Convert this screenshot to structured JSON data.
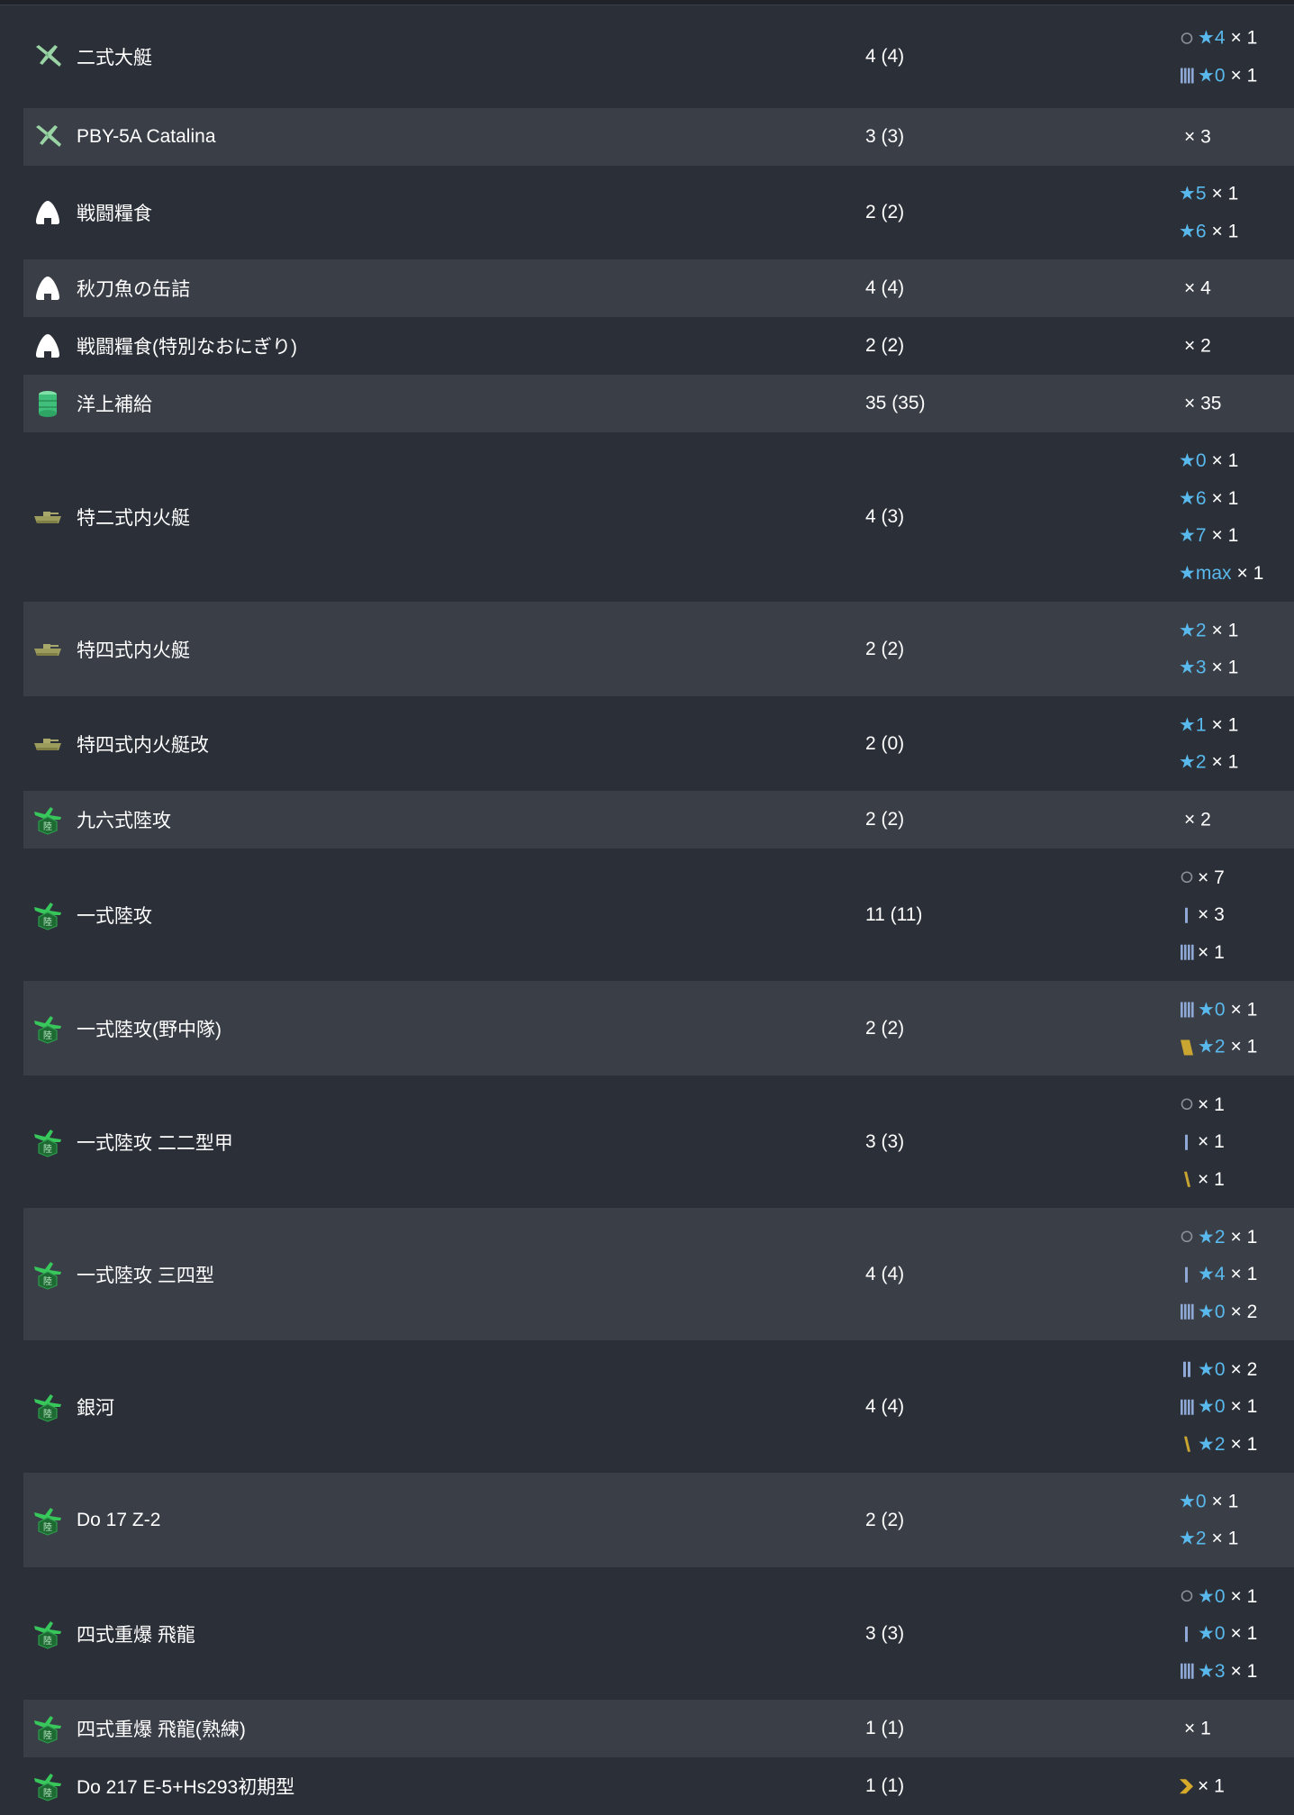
{
  "rows": [
    {
      "icon": "flying-boat-icon",
      "name": "二式大艇",
      "count": "4 (4)",
      "improvements": [
        {
          "prof": "circle",
          "star": "★4",
          "mult": "× 1"
        },
        {
          "prof": "bars4",
          "star": "★0",
          "mult": "× 1"
        }
      ]
    },
    {
      "icon": "flying-boat-icon",
      "name": "PBY-5A Catalina",
      "count": "3 (3)",
      "improvements": [
        {
          "prof": "none",
          "star": "",
          "mult": "× 3"
        }
      ]
    },
    {
      "icon": "ration-icon",
      "name": "戦闘糧食",
      "count": "2 (2)",
      "improvements": [
        {
          "prof": "",
          "star": "★5",
          "mult": "× 1"
        },
        {
          "prof": "",
          "star": "★6",
          "mult": "× 1"
        }
      ]
    },
    {
      "icon": "ration-icon",
      "name": "秋刀魚の缶詰",
      "count": "4 (4)",
      "improvements": [
        {
          "prof": "none",
          "star": "",
          "mult": "× 4"
        }
      ]
    },
    {
      "icon": "ration-icon",
      "name": "戦闘糧食(特別なおにぎり)",
      "count": "2 (2)",
      "improvements": [
        {
          "prof": "none",
          "star": "",
          "mult": "× 2"
        }
      ]
    },
    {
      "icon": "supply-drum-icon",
      "name": "洋上補給",
      "count": "35 (35)",
      "improvements": [
        {
          "prof": "none",
          "star": "",
          "mult": "× 35"
        }
      ]
    },
    {
      "icon": "tank-icon",
      "name": "特二式内火艇",
      "count": "4 (3)",
      "improvements": [
        {
          "prof": "",
          "star": "★0",
          "mult": "× 1"
        },
        {
          "prof": "",
          "star": "★6",
          "mult": "× 1"
        },
        {
          "prof": "",
          "star": "★7",
          "mult": "× 1"
        },
        {
          "prof": "",
          "star": "★max",
          "mult": "× 1"
        }
      ]
    },
    {
      "icon": "tank-icon",
      "name": "特四式内火艇",
      "count": "2 (2)",
      "improvements": [
        {
          "prof": "",
          "star": "★2",
          "mult": "× 1"
        },
        {
          "prof": "",
          "star": "★3",
          "mult": "× 1"
        }
      ]
    },
    {
      "icon": "tank-icon",
      "name": "特四式内火艇改",
      "count": "2 (0)",
      "improvements": [
        {
          "prof": "",
          "star": "★1",
          "mult": "× 1"
        },
        {
          "prof": "",
          "star": "★2",
          "mult": "× 1"
        }
      ]
    },
    {
      "icon": "land-bomber-icon",
      "name": "九六式陸攻",
      "count": "2 (2)",
      "improvements": [
        {
          "prof": "none",
          "star": "",
          "mult": "× 2"
        }
      ]
    },
    {
      "icon": "land-bomber-icon",
      "name": "一式陸攻",
      "count": "11 (11)",
      "improvements": [
        {
          "prof": "circle",
          "star": "",
          "mult": "× 7"
        },
        {
          "prof": "bar1",
          "star": "",
          "mult": "× 3"
        },
        {
          "prof": "bars4",
          "star": "",
          "mult": "× 1"
        }
      ]
    },
    {
      "icon": "land-bomber-icon",
      "name": "一式陸攻(野中隊)",
      "count": "2 (2)",
      "improvements": [
        {
          "prof": "bars4",
          "star": "★0",
          "mult": "× 1"
        },
        {
          "prof": "gold-wide",
          "star": "★2",
          "mult": "× 1"
        }
      ]
    },
    {
      "icon": "land-bomber-icon",
      "name": "一式陸攻 二二型甲",
      "count": "3 (3)",
      "improvements": [
        {
          "prof": "circle",
          "star": "",
          "mult": "× 1"
        },
        {
          "prof": "bar1",
          "star": "",
          "mult": "× 1"
        },
        {
          "prof": "gold-slash",
          "star": "",
          "mult": "× 1"
        }
      ]
    },
    {
      "icon": "land-bomber-icon",
      "name": "一式陸攻 三四型",
      "count": "4 (4)",
      "improvements": [
        {
          "prof": "circle",
          "star": "★2",
          "mult": "× 1"
        },
        {
          "prof": "bar1",
          "star": "★4",
          "mult": "× 1"
        },
        {
          "prof": "bars4",
          "star": "★0",
          "mult": "× 2"
        }
      ]
    },
    {
      "icon": "land-bomber-icon",
      "name": "銀河",
      "count": "4 (4)",
      "improvements": [
        {
          "prof": "bars2",
          "star": "★0",
          "mult": "× 2"
        },
        {
          "prof": "bars4",
          "star": "★0",
          "mult": "× 1"
        },
        {
          "prof": "gold-slash",
          "star": "★2",
          "mult": "× 1"
        }
      ]
    },
    {
      "icon": "land-bomber-icon",
      "name": "Do 17 Z-2",
      "count": "2 (2)",
      "improvements": [
        {
          "prof": "",
          "star": "★0",
          "mult": "× 1"
        },
        {
          "prof": "",
          "star": "★2",
          "mult": "× 1"
        }
      ]
    },
    {
      "icon": "land-bomber-icon",
      "name": "四式重爆 飛龍",
      "count": "3 (3)",
      "improvements": [
        {
          "prof": "circle",
          "star": "★0",
          "mult": "× 1"
        },
        {
          "prof": "bar1",
          "star": "★0",
          "mult": "× 1"
        },
        {
          "prof": "bars4",
          "star": "★3",
          "mult": "× 1"
        }
      ]
    },
    {
      "icon": "land-bomber-icon",
      "name": "四式重爆 飛龍(熟練)",
      "count": "1 (1)",
      "improvements": [
        {
          "prof": "none",
          "star": "",
          "mult": "× 1"
        }
      ]
    },
    {
      "icon": "land-bomber-icon",
      "name": "Do 217 E-5+Hs293初期型",
      "count": "1 (1)",
      "improvements": [
        {
          "prof": "chevron",
          "star": "",
          "mult": "× 1"
        }
      ]
    }
  ]
}
